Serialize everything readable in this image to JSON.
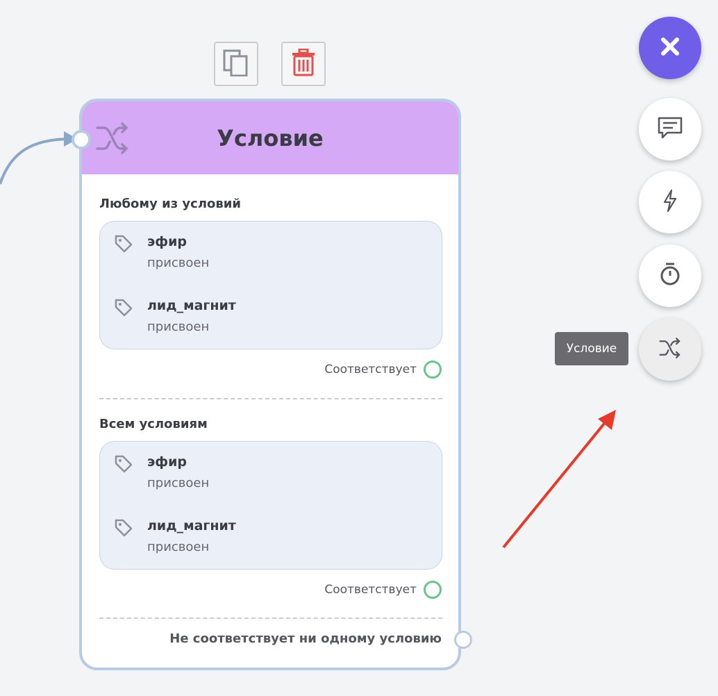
{
  "node": {
    "title": "Условие",
    "icon": "shuffle-icon",
    "sections": [
      {
        "title": "Любому из условий",
        "conditions": [
          {
            "tag": "эфир",
            "state": "присвоен"
          },
          {
            "tag": "лид_магнит",
            "state": "присвоен"
          }
        ],
        "match_label": "Соответствует"
      },
      {
        "title": "Всем условиям",
        "conditions": [
          {
            "tag": "эфир",
            "state": "присвоен"
          },
          {
            "tag": "лид_магнит",
            "state": "присвоен"
          }
        ],
        "match_label": "Соответствует"
      }
    ],
    "no_match_label": "Не соответствует ни одному условию"
  },
  "toolbar": {
    "copy_icon": "copy-icon",
    "delete_icon": "trash-icon"
  },
  "sidebar": {
    "buttons": [
      "close-icon",
      "message-icon",
      "bolt-icon",
      "timer-icon",
      "shuffle-icon"
    ],
    "tooltip": "Условие"
  },
  "colors": {
    "header": "#d6a9f7",
    "accent": "#6f5fe8",
    "delete": "#e0524f",
    "match_port": "#6cc38e",
    "edge": "#8aa6c8",
    "arrow": "#e53b2a"
  }
}
